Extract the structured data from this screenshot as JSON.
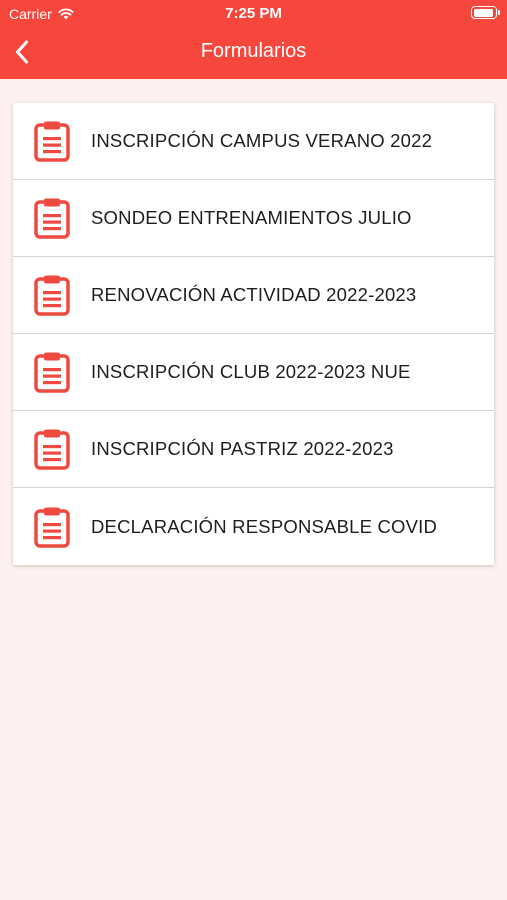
{
  "status_bar": {
    "carrier": "Carrier",
    "time": "7:25 PM"
  },
  "nav": {
    "title": "Formularios",
    "back_icon": "chevron-left-icon"
  },
  "forms": [
    {
      "label": "INSCRIPCIÓN CAMPUS VERANO 2022",
      "icon": "clipboard-icon"
    },
    {
      "label": "SONDEO ENTRENAMIENTOS JULIO",
      "icon": "clipboard-icon"
    },
    {
      "label": "RENOVACIÓN ACTIVIDAD 2022-2023",
      "icon": "clipboard-icon"
    },
    {
      "label": "INSCRIPCIÓN CLUB 2022-2023 NUE",
      "icon": "clipboard-icon"
    },
    {
      "label": "INSCRIPCIÓN PASTRIZ 2022-2023",
      "icon": "clipboard-icon"
    },
    {
      "label": "DECLARACIÓN RESPONSABLE COVID",
      "icon": "clipboard-icon"
    }
  ],
  "colors": {
    "accent": "#f7463c",
    "background": "#fdf0ee",
    "card": "#ffffff",
    "text": "#1e1e1e"
  }
}
